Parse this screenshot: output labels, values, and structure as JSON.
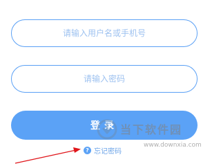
{
  "login_form": {
    "username_placeholder": "请输入用户名或手机号",
    "password_placeholder": "请输入密码",
    "login_button_label": "登录",
    "forgot_password_label": "忘记密码",
    "forgot_icon_glyph": "?"
  },
  "watermark": {
    "name": "当下软件园",
    "url": "www.downxia.com"
  },
  "colors": {
    "accent": "#5ba2f6",
    "field_border": "#5aa0f5",
    "annotation_arrow": "#e0161b"
  }
}
